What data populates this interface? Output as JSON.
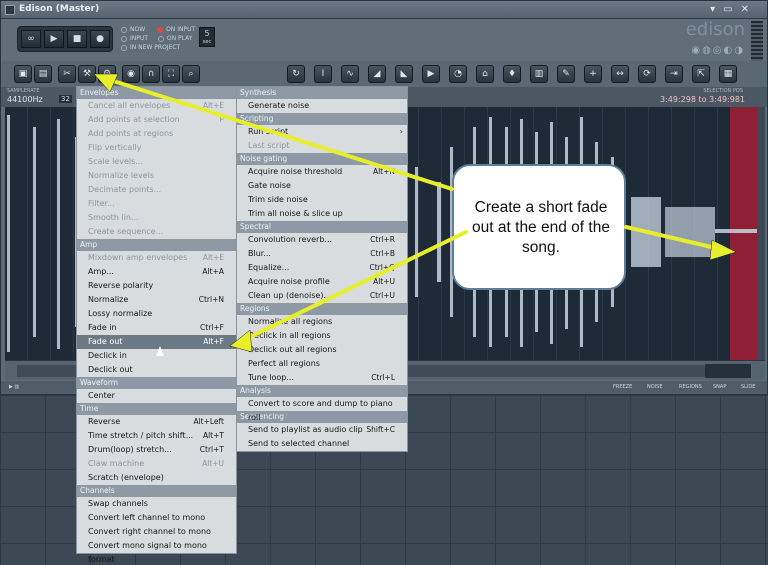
{
  "window": {
    "title": "Edison (Master)"
  },
  "transport": {
    "loop": "∞",
    "play": "▶",
    "stop": "■",
    "record": "●"
  },
  "options": {
    "now": "NOW",
    "input": "INPUT",
    "on_input": "ON INPUT",
    "on_play": "ON PLAY",
    "in_new_project": "IN NEW PROJECT",
    "count_label": "5",
    "count_unit": "sec"
  },
  "logo": {
    "text": "edison"
  },
  "info": {
    "sample_rate_label": "SAMPLERATE",
    "sample_rate": "44100Hz",
    "bits": "32",
    "time_label": "SELECTION POS",
    "time_start": "3:49:298",
    "time_to": "to",
    "time_end": "3:49:981"
  },
  "status": {
    "freeze": "FREEZE",
    "noise": "NOISE",
    "regions": "REGIONS",
    "snap": "SNAP",
    "slide": "SLIDE"
  },
  "colors": {
    "selection": "#8e1f34",
    "arrow": "#e6ef2a",
    "menu_highlight": "#6c7a86"
  },
  "menu_left": {
    "sections": [
      {
        "header": "Envelopes",
        "items": [
          {
            "label": "Cancel all envelopes",
            "shortcut": "Alt+E",
            "disabled": true
          },
          {
            "label": "Add points at selection",
            "shortcut": "P",
            "disabled": true
          },
          {
            "label": "Add points at regions",
            "shortcut": "",
            "disabled": true
          },
          {
            "label": "Flip vertically",
            "shortcut": "",
            "disabled": true
          },
          {
            "label": "Scale levels...",
            "shortcut": "",
            "disabled": true
          },
          {
            "label": "Normalize levels",
            "shortcut": "",
            "disabled": true
          },
          {
            "label": "Decimate points...",
            "shortcut": "",
            "disabled": true
          },
          {
            "label": "Filter...",
            "shortcut": "",
            "disabled": true
          },
          {
            "label": "Smooth lin...",
            "shortcut": "",
            "disabled": true
          },
          {
            "label": "Create sequence...",
            "shortcut": "",
            "disabled": true
          }
        ]
      },
      {
        "header": "Amp",
        "items": [
          {
            "label": "Mixdown amp envelopes",
            "shortcut": "Alt+E",
            "disabled": true
          },
          {
            "label": "Amp...",
            "shortcut": "Alt+A",
            "disabled": false
          },
          {
            "label": "Reverse polarity",
            "shortcut": "",
            "disabled": false
          },
          {
            "label": "Normalize",
            "shortcut": "Ctrl+N",
            "disabled": false
          },
          {
            "label": "Lossy normalize",
            "shortcut": "",
            "disabled": false
          },
          {
            "label": "Fade in",
            "shortcut": "Ctrl+F",
            "disabled": false
          },
          {
            "label": "Fade out",
            "shortcut": "Alt+F",
            "disabled": false,
            "highlighted": true
          },
          {
            "label": "Declick in",
            "shortcut": "",
            "disabled": false
          },
          {
            "label": "Declick out",
            "shortcut": "",
            "disabled": false
          }
        ]
      },
      {
        "header": "Waveform",
        "items": [
          {
            "label": "Center",
            "shortcut": "",
            "disabled": false
          }
        ]
      },
      {
        "header": "Time",
        "items": [
          {
            "label": "Reverse",
            "shortcut": "Alt+Left",
            "disabled": false
          },
          {
            "label": "Time stretch / pitch shift...",
            "shortcut": "Alt+T",
            "disabled": false
          },
          {
            "label": "Drum(loop) stretch...",
            "shortcut": "Ctrl+T",
            "disabled": false
          },
          {
            "label": "Claw machine",
            "shortcut": "Alt+U",
            "disabled": true
          },
          {
            "label": "Scratch (envelope)",
            "shortcut": "",
            "disabled": false
          }
        ]
      },
      {
        "header": "Channels",
        "items": [
          {
            "label": "Swap channels",
            "shortcut": "",
            "disabled": false
          },
          {
            "label": "Convert left channel to mono",
            "shortcut": "",
            "disabled": false
          },
          {
            "label": "Convert right channel to mono",
            "shortcut": "",
            "disabled": false
          },
          {
            "label": "Convert mono signal to mono format",
            "shortcut": "",
            "disabled": false
          }
        ]
      }
    ]
  },
  "menu_right": {
    "sections": [
      {
        "header": "Synthesis",
        "items": [
          {
            "label": "Generate noise",
            "shortcut": "",
            "disabled": false
          }
        ]
      },
      {
        "header": "Scripting",
        "items": [
          {
            "label": "Run script",
            "shortcut": "",
            "disabled": false,
            "submenu": true
          },
          {
            "label": "Last script",
            "shortcut": "",
            "disabled": true
          }
        ]
      },
      {
        "header": "Noise gating",
        "items": [
          {
            "label": "Acquire noise threshold",
            "shortcut": "Alt+N",
            "disabled": false
          },
          {
            "label": "Gate noise",
            "shortcut": "",
            "disabled": false
          },
          {
            "label": "Trim side noise",
            "shortcut": "",
            "disabled": false
          },
          {
            "label": "Trim all noise & slice up",
            "shortcut": "",
            "disabled": false
          }
        ]
      },
      {
        "header": "Spectral",
        "items": [
          {
            "label": "Convolution reverb...",
            "shortcut": "Ctrl+R",
            "disabled": false
          },
          {
            "label": "Blur...",
            "shortcut": "Ctrl+B",
            "disabled": false
          },
          {
            "label": "Equalize...",
            "shortcut": "Ctrl+Q",
            "disabled": false
          },
          {
            "label": "Acquire noise profile",
            "shortcut": "Alt+U",
            "disabled": false
          },
          {
            "label": "Clean up (denoise)...",
            "shortcut": "Ctrl+U",
            "disabled": false
          }
        ]
      },
      {
        "header": "Regions",
        "items": [
          {
            "label": "Normalize all regions",
            "shortcut": "",
            "disabled": false
          },
          {
            "label": "Declick in all regions",
            "shortcut": "",
            "disabled": false
          },
          {
            "label": "Declick out all regions",
            "shortcut": "",
            "disabled": false
          },
          {
            "label": "Perfect all regions",
            "shortcut": "",
            "disabled": false
          },
          {
            "label": "Tune loop...",
            "shortcut": "Ctrl+L",
            "disabled": false
          }
        ]
      },
      {
        "header": "Analysis",
        "items": [
          {
            "label": "Convert to score and dump to piano roll",
            "shortcut": "",
            "disabled": false
          }
        ]
      },
      {
        "header": "Sequencing",
        "items": [
          {
            "label": "Send to playlist as audio clip",
            "shortcut": "Shift+C",
            "disabled": false
          },
          {
            "label": "Send to selected channel",
            "shortcut": "",
            "disabled": false
          }
        ]
      }
    ]
  },
  "callout": {
    "text": "Create a short fade out at the end of the song."
  }
}
